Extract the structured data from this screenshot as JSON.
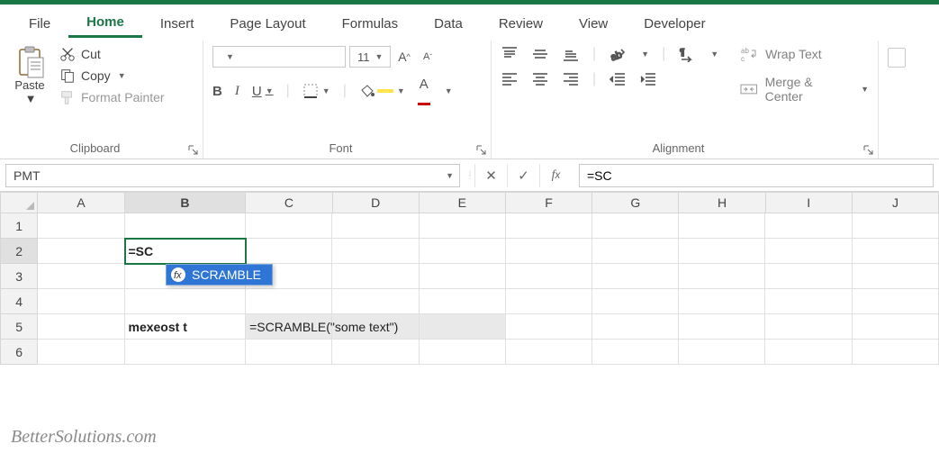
{
  "tabs": {
    "file": "File",
    "home": "Home",
    "insert": "Insert",
    "page_layout": "Page Layout",
    "formulas": "Formulas",
    "data": "Data",
    "review": "Review",
    "view": "View",
    "developer": "Developer"
  },
  "clipboard": {
    "paste": "Paste",
    "cut": "Cut",
    "copy": "Copy",
    "format_painter": "Format Painter",
    "group": "Clipboard"
  },
  "font": {
    "name": "",
    "size": "11",
    "group": "Font"
  },
  "align": {
    "wrap": "Wrap Text",
    "merge": "Merge & Center",
    "group": "Alignment"
  },
  "fx": {
    "namebox": "PMT",
    "formula": "=SC"
  },
  "cols": [
    "A",
    "B",
    "C",
    "D",
    "E",
    "F",
    "G",
    "H",
    "I",
    "J"
  ],
  "rows": [
    "1",
    "2",
    "3",
    "4",
    "5",
    "6"
  ],
  "cells": {
    "b2": "=SC",
    "b5": "mexeost t",
    "c5": "=SCRAMBLE(\"some text\")"
  },
  "autocomplete": {
    "item": "SCRAMBLE"
  },
  "watermark": "BetterSolutions.com"
}
